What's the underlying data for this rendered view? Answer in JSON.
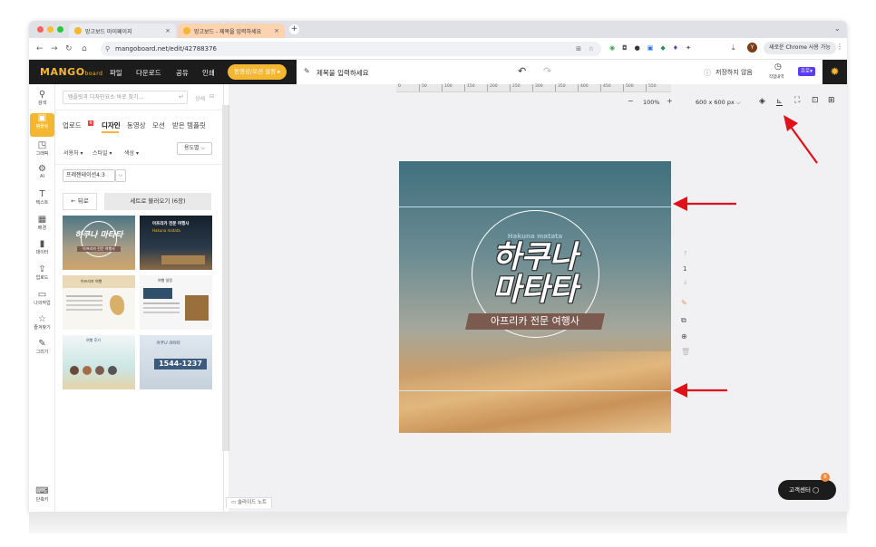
{
  "browser": {
    "tabs": [
      {
        "label": "망고보드 마이페이지"
      },
      {
        "label": "망고보드 - 제목을 입력하세요"
      }
    ],
    "new_tab": "+",
    "url": "mangoboard.net/edit/42788376",
    "chrome_prompt": "새로운 Chrome 사용 가능",
    "profile_initial": "Y"
  },
  "app": {
    "logo": "MANGO",
    "logo_suffix": "board",
    "menus": [
      "파일",
      "다운로드",
      "공유",
      "인쇄"
    ],
    "settings_button": "동영상/모션 설정 ▸",
    "title_placeholder": "제목을 입력하세요",
    "save_status": "저장하지 않음",
    "history_label": "작업내역",
    "pro_badge": "프로▾"
  },
  "left_rail": [
    {
      "label": "검색",
      "icon": "search-icon",
      "glyph": "🔍"
    },
    {
      "label": "템플릿",
      "icon": "template-icon",
      "glyph": "▣"
    },
    {
      "label": "그래픽",
      "icon": "graphic-icon",
      "glyph": "◳"
    },
    {
      "label": "AI",
      "icon": "ai-icon",
      "glyph": "⚙"
    },
    {
      "label": "텍스트",
      "icon": "text-icon",
      "glyph": "T"
    },
    {
      "label": "배경",
      "icon": "background-icon",
      "glyph": "▦"
    },
    {
      "label": "데이터",
      "icon": "data-icon",
      "glyph": "▮"
    },
    {
      "label": "업로드",
      "icon": "upload-icon",
      "glyph": "⇪"
    },
    {
      "label": "나의작업",
      "icon": "my-work-icon",
      "glyph": "▭"
    },
    {
      "label": "즐겨찾기",
      "icon": "star-icon",
      "glyph": "☆"
    },
    {
      "label": "그리기",
      "icon": "draw-icon",
      "glyph": "✎"
    },
    {
      "label": "단축키",
      "icon": "keyboard-icon",
      "glyph": "⌨"
    }
  ],
  "panel": {
    "search_placeholder": "템플릿과 디자인요소 바로 찾기...",
    "detail_link": "상세",
    "tabs": [
      "업로드",
      "디자인",
      "동영상",
      "모션",
      "받은 템플릿"
    ],
    "filters": [
      "서용처 ▾",
      "스타일 ▾",
      "색상 ▾"
    ],
    "usage_select": "용도별 ⌵",
    "size_select": "프레젠테이션4:3",
    "back_button": "← 뒤로",
    "load_set_button": "세트로 불러오기 (6장)",
    "thumbs": [
      {
        "title": "하쿠나 마타타",
        "sub": "아프리카 전문 여행사"
      },
      {
        "title": "아프리카 전문 여행사",
        "sub": "Hakuna matata"
      },
      {
        "title": "아프리카 여행",
        "sub": ""
      },
      {
        "title": "여행 일정",
        "sub": ""
      },
      {
        "title": "여행 후기",
        "sub": ""
      },
      {
        "title": "1544-1237",
        "sub": "하쿠나 마타타"
      }
    ]
  },
  "canvas": {
    "zoom": "100%",
    "zoom_minus": "−",
    "zoom_plus": "+",
    "size": "600 x 600 px",
    "ruler_ticks": [
      "0",
      "50",
      "100",
      "150",
      "200",
      "250",
      "300",
      "350",
      "400",
      "450",
      "500",
      "550"
    ],
    "page_number": "1",
    "design": {
      "eyebrow": "Hakuna matata",
      "headline_1": "하쿠나",
      "headline_2": "마타타",
      "subtitle": "아프리카 전문 여행사"
    },
    "slide_note": "슬라이드 노트"
  },
  "support": {
    "label": "고객센터",
    "badge": "8"
  },
  "colors": {
    "accent": "#f4b731",
    "arrow": "#e0111a",
    "pro": "#5b3df5",
    "appbar": "#1c1c1c"
  }
}
